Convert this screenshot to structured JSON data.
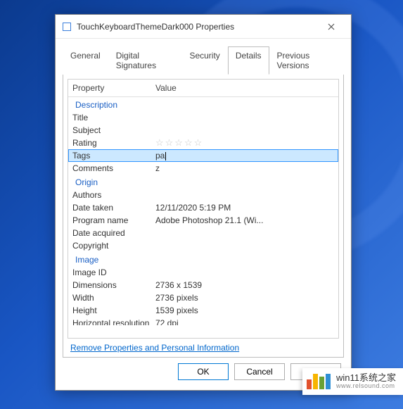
{
  "window": {
    "title": "TouchKeyboardThemeDark000 Properties"
  },
  "tabs": [
    {
      "label": "General"
    },
    {
      "label": "Digital Signatures"
    },
    {
      "label": "Security"
    },
    {
      "label": "Details",
      "active": true
    },
    {
      "label": "Previous Versions"
    }
  ],
  "grid": {
    "header_property": "Property",
    "header_value": "Value",
    "sections": {
      "description": "Description",
      "origin": "Origin",
      "image": "Image"
    },
    "rows": {
      "title": {
        "label": "Title",
        "value": ""
      },
      "subject": {
        "label": "Subject",
        "value": ""
      },
      "rating": {
        "label": "Rating",
        "value": ""
      },
      "tags": {
        "label": "Tags",
        "value": "pa"
      },
      "comments": {
        "label": "Comments",
        "value": "z"
      },
      "authors": {
        "label": "Authors",
        "value": ""
      },
      "date_taken": {
        "label": "Date taken",
        "value": "12/11/2020 5:19 PM"
      },
      "program_name": {
        "label": "Program name",
        "value": "Adobe Photoshop 21.1 (Wi..."
      },
      "date_acquired": {
        "label": "Date acquired",
        "value": ""
      },
      "copyright": {
        "label": "Copyright",
        "value": ""
      },
      "image_id": {
        "label": "Image ID",
        "value": ""
      },
      "dimensions": {
        "label": "Dimensions",
        "value": "2736 x 1539"
      },
      "width": {
        "label": "Width",
        "value": "2736 pixels"
      },
      "height": {
        "label": "Height",
        "value": "1539 pixels"
      },
      "h_res": {
        "label": "Horizontal resolution",
        "value": "72 dpi"
      }
    }
  },
  "link_remove": "Remove Properties and Personal Information",
  "buttons": {
    "ok": "OK",
    "cancel": "Cancel",
    "apply": "Apply"
  },
  "watermark": {
    "line1": "win11系统之家",
    "line2": "www.relsound.com",
    "colors": [
      "#e2522e",
      "#f7b500",
      "#6aa135",
      "#2f8fd4"
    ]
  }
}
